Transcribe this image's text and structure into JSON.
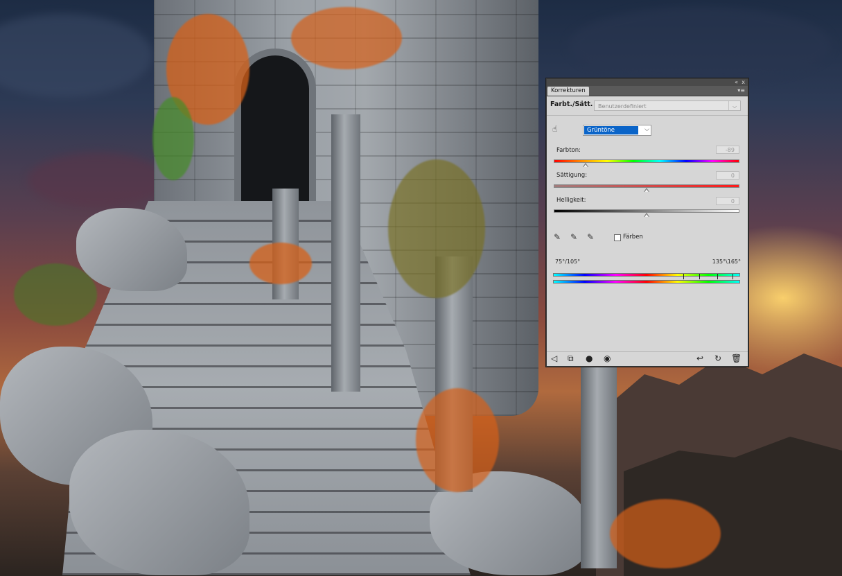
{
  "panel": {
    "tab_label": "Korrekturen",
    "collapse_glyph": "«",
    "close_glyph": "x",
    "menu_glyph": "▾≡",
    "adjustment_title": "Farbt./Sätt.",
    "preset_value": "Benutzerdefiniert",
    "preset_arrow": "⌵",
    "hand_tool_icon": "target-hand-icon",
    "hand_tool_glyph": "☝",
    "color_range": {
      "value": "Grüntöne",
      "arrow": "⌵"
    },
    "hue": {
      "label": "Farbton:",
      "value": "-89",
      "slider_fraction": 0.17
    },
    "saturation": {
      "label": "Sättigung:",
      "value": "0",
      "slider_fraction": 0.5
    },
    "lightness": {
      "label": "Helligkeit:",
      "value": "0",
      "slider_fraction": 0.5
    },
    "eyedroppers": [
      "eyedropper-icon",
      "eyedropper-plus-icon",
      "eyedropper-minus-icon"
    ],
    "eyedropper_glyph": "✎",
    "colorize": {
      "label": "Färben",
      "checked": false
    },
    "range_left": "75°/105°",
    "range_right": "135°\\165°",
    "bottom_icons": {
      "left": [
        {
          "name": "back-arrow-icon",
          "glyph": "◁"
        },
        {
          "name": "clip-to-layer-icon",
          "glyph": "⧉"
        },
        {
          "name": "layer-mask-icon",
          "glyph": "●"
        },
        {
          "name": "visibility-eye-icon",
          "glyph": "◉"
        }
      ],
      "right": [
        {
          "name": "view-previous-state-icon",
          "glyph": "↩"
        },
        {
          "name": "reset-icon",
          "glyph": "↻"
        },
        {
          "name": "delete-trash-icon",
          "glyph": "🗑"
        }
      ]
    }
  }
}
